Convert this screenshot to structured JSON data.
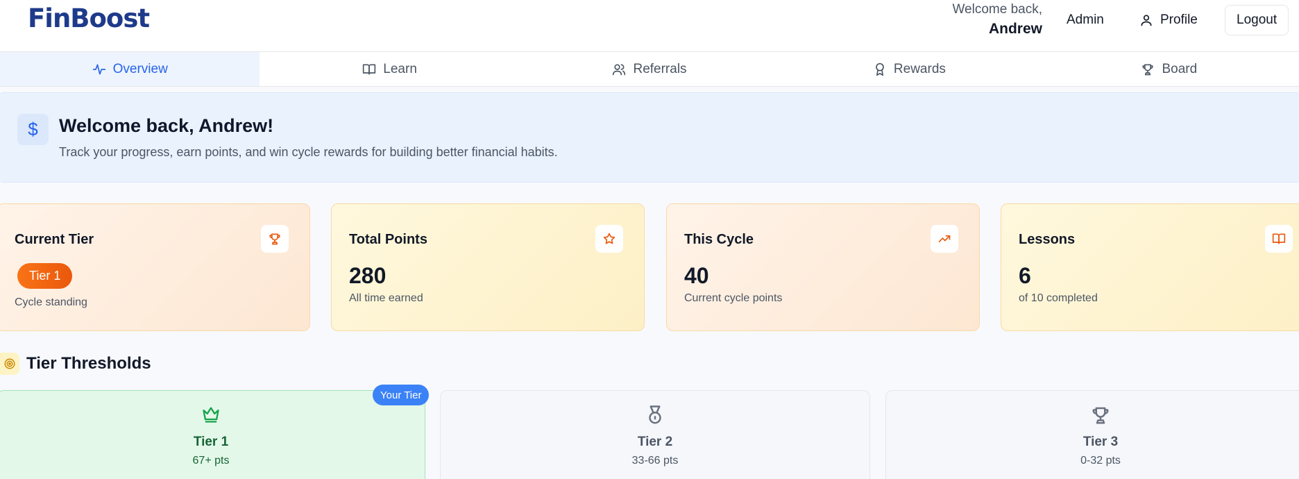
{
  "header": {
    "logo": "FinBoost",
    "welcome_small": "Welcome back,",
    "welcome_name": "Andrew",
    "admin_label": "Admin",
    "profile_label": "Profile",
    "logout_label": "Logout"
  },
  "nav": {
    "tabs": [
      {
        "label": "Overview",
        "icon": "activity-icon",
        "active": true
      },
      {
        "label": "Learn",
        "icon": "book-icon",
        "active": false
      },
      {
        "label": "Referrals",
        "icon": "users-icon",
        "active": false
      },
      {
        "label": "Rewards",
        "icon": "award-icon",
        "active": false
      },
      {
        "label": "Board",
        "icon": "trophy-icon",
        "active": false
      }
    ]
  },
  "banner": {
    "title": "Welcome back, Andrew!",
    "subtitle": "Track your progress, earn points, and win cycle rewards for building better financial habits.",
    "icon": "dollar-icon"
  },
  "stats": [
    {
      "title": "Current Tier",
      "pill": "Tier 1",
      "sub": "Cycle standing",
      "icon": "trophy-icon"
    },
    {
      "title": "Total Points",
      "value": "280",
      "sub": "All time earned",
      "icon": "star-icon"
    },
    {
      "title": "This Cycle",
      "value": "40",
      "sub": "Current cycle points",
      "icon": "trending-up-icon"
    },
    {
      "title": "Lessons",
      "value": "6",
      "sub": "of 10 completed",
      "icon": "book-icon"
    }
  ],
  "thresholds": {
    "title": "Tier Thresholds",
    "badge": "Your Tier",
    "tiers": [
      {
        "name": "Tier 1",
        "points": "67+ pts",
        "icon": "crown-icon"
      },
      {
        "name": "Tier 2",
        "points": "33-66 pts",
        "icon": "medal-icon"
      },
      {
        "name": "Tier 3",
        "points": "0-32 pts",
        "icon": "trophy-icon"
      }
    ]
  },
  "colors": {
    "brand": "#1e3a8a",
    "accent": "#2563eb",
    "tier_pill": "#f97316",
    "tier1_green": "#16a34a"
  }
}
